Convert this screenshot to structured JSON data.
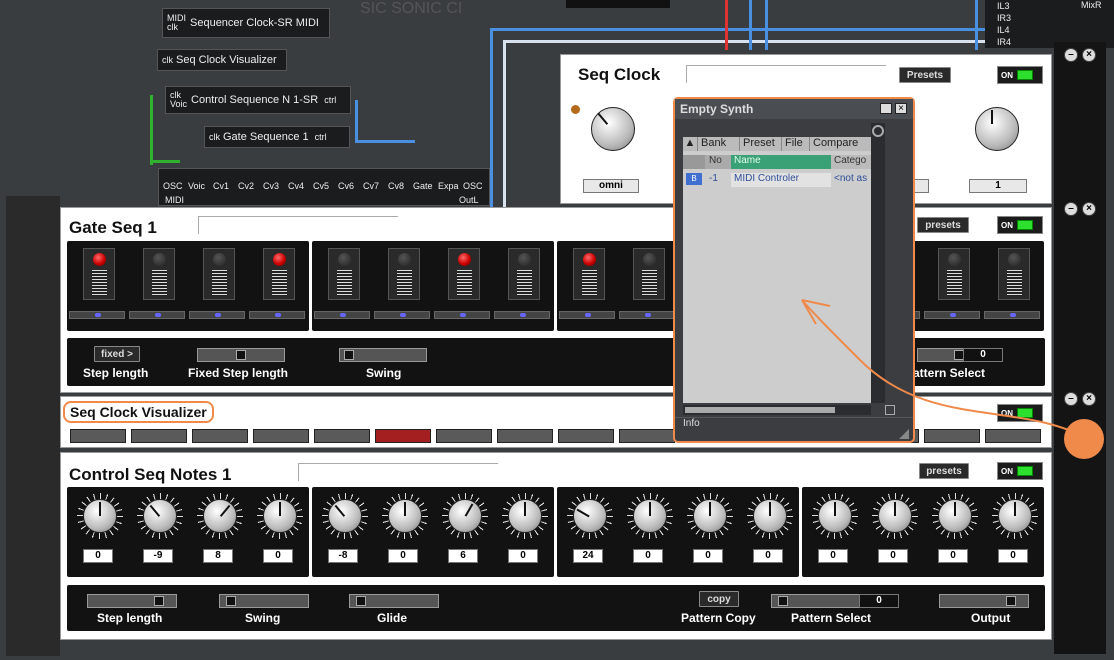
{
  "nodes": {
    "seq_clock_midi": {
      "ports_top": "MIDI",
      "ports_bottom": "clk",
      "label": "Sequencer Clock-SR MIDI"
    },
    "seq_clock_vis": {
      "port": "clk",
      "label": "Seq Clock Visualizer"
    },
    "control_seq": {
      "ports_top": "clk",
      "ports_bottom": "Voic",
      "label": "Control Sequence N 1-SR",
      "out": "ctrl"
    },
    "gate_seq": {
      "port": "clk",
      "label": "Gate Sequence 1",
      "out": "ctrl"
    },
    "bus_ports": [
      "OSC",
      "Voic",
      "Cv1",
      "Cv2",
      "Cv3",
      "Cv4",
      "Cv5",
      "Cv6",
      "Cv7",
      "Cv8",
      "Gate",
      "Expa",
      "OSC"
    ],
    "bus_midi": "MIDI",
    "bus_outl": "OutL",
    "right_ports": [
      "IL3",
      "IR3",
      "IL4",
      "IR4"
    ],
    "mixr": "MixR"
  },
  "seq_clock": {
    "title": "Seq Clock",
    "presets": "Presets",
    "on": "ON",
    "left_value": "omni",
    "right_value": "1"
  },
  "gate_seq": {
    "title": "Gate Seq 1",
    "presets": "presets",
    "on": "ON",
    "fixed_btn": "fixed >",
    "labels": [
      "Step length",
      "Fixed Step length",
      "Swing",
      "Pattern Select"
    ],
    "pattern_value": "0",
    "leds": [
      true,
      false,
      false,
      true,
      false,
      false,
      true,
      false,
      true,
      false,
      false,
      false,
      false,
      false,
      false,
      false
    ]
  },
  "visualizer": {
    "title": "Seq Clock Visualizer",
    "on": "ON",
    "active_index": 5
  },
  "control_seq": {
    "title": "Control Seq Notes 1",
    "presets": "presets",
    "on": "ON",
    "knob_values": [
      "0",
      "-9",
      "8",
      "0",
      "-8",
      "0",
      "6",
      "0",
      "24",
      "0",
      "0",
      "0",
      "0",
      "0",
      "0",
      "0"
    ],
    "copy_btn": "copy",
    "pattern_value": "0",
    "labels": [
      "Step length",
      "Swing",
      "Glide",
      "Pattern Copy",
      "Pattern Select",
      "Output"
    ]
  },
  "dialog": {
    "title": "Empty Synth",
    "tabs": [
      "Bank",
      "Preset",
      "File",
      "Compare"
    ],
    "columns": [
      "No",
      "Name",
      "Catego"
    ],
    "row": {
      "badge": "B",
      "no": "-1",
      "name": "MIDI Controler",
      "cat": "<not as"
    },
    "info": "Info"
  },
  "bg_text": "SIC SONIC CI",
  "colors": {
    "accent": "#f08a4b",
    "led_on": "#cc0000",
    "on_green": "#2ee02e",
    "wire": "#4a90e2"
  }
}
